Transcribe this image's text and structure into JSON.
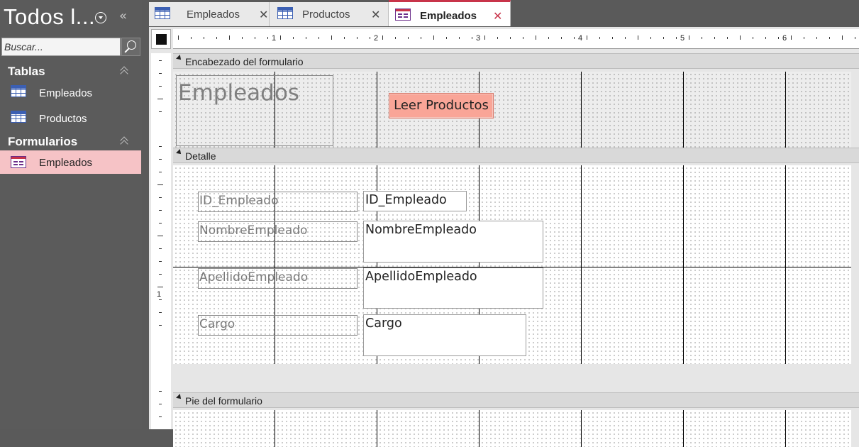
{
  "nav": {
    "title": "Todos l...",
    "search": {
      "placeholder": "Buscar..."
    },
    "groups": [
      {
        "label": "Tablas",
        "items": [
          {
            "label": "Empleados",
            "icon": "table-icon"
          },
          {
            "label": "Productos",
            "icon": "table-icon"
          }
        ]
      },
      {
        "label": "Formularios",
        "items": [
          {
            "label": "Empleados",
            "icon": "form-icon",
            "selected": true
          }
        ]
      }
    ]
  },
  "tabs": [
    {
      "label": "Empleados",
      "icon": "table-icon",
      "active": false
    },
    {
      "label": "Productos",
      "icon": "table-icon",
      "active": false
    },
    {
      "label": "Empleados",
      "icon": "form-icon",
      "active": true
    }
  ],
  "ruler": {
    "numbers": [
      "1",
      "2",
      "3",
      "4",
      "5",
      "6"
    ],
    "vertical_numbers": [
      "1"
    ]
  },
  "form": {
    "sections": {
      "header": "Encabezado del formulario",
      "detail": "Detalle",
      "footer": "Pie del formulario"
    },
    "title": "Empleados",
    "button": "Leer Productos",
    "fields": [
      {
        "label": "ID_Empleado",
        "control": "ID_Empleado"
      },
      {
        "label": "NombreEmpleado",
        "control": "NombreEmpleado"
      },
      {
        "label": "ApellidoEmpleado",
        "control": "ApellidoEmpleado"
      },
      {
        "label": "Cargo",
        "control": "Cargo"
      }
    ]
  },
  "colors": {
    "accent": "#c8344a",
    "selected_nav": "#f6c3c6",
    "button": "#f9a597",
    "nav_bg": "#5b5b5b"
  }
}
